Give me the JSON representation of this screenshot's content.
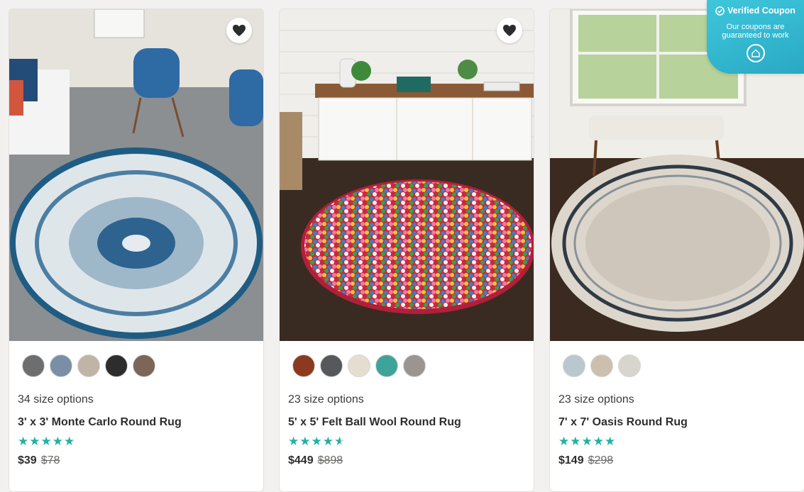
{
  "products": [
    {
      "sizes": "34 size options",
      "title": "3' x 3' Monte Carlo Round Rug",
      "rating": 5,
      "price": "$39",
      "original_price": "$78",
      "swatch_colors": [
        "#6d6e6f",
        "#7a8fa6",
        "#bfb4a6",
        "#2d2d2d",
        "#7b6658"
      ]
    },
    {
      "sizes": "23 size options",
      "title": "5' x 5' Felt Ball Wool Round Rug",
      "rating": 4.5,
      "price": "$449",
      "original_price": "$898",
      "swatch_colors": [
        "#8c3a1f",
        "#56585b",
        "#e5ddd0",
        "#3da49a",
        "#9b9490"
      ]
    },
    {
      "sizes": "23 size options",
      "title": "7' x 7' Oasis Round Rug",
      "rating": 5,
      "price": "$149",
      "original_price": "$298",
      "swatch_colors": [
        "#b9c8cf",
        "#cdbfae",
        "#d8d5cf"
      ]
    }
  ],
  "coupon": {
    "title": "Verified Coupon",
    "description": "Our coupons are guaranteed to work"
  },
  "colors": {
    "star": "#1fb1a6",
    "coupon_bg": "#35bcd3"
  },
  "icons": {
    "favorite": "heart-icon",
    "coupon_check": "check-circle-icon",
    "coupon_badge": "coupon-badge-icon",
    "rating": "star-icon"
  }
}
